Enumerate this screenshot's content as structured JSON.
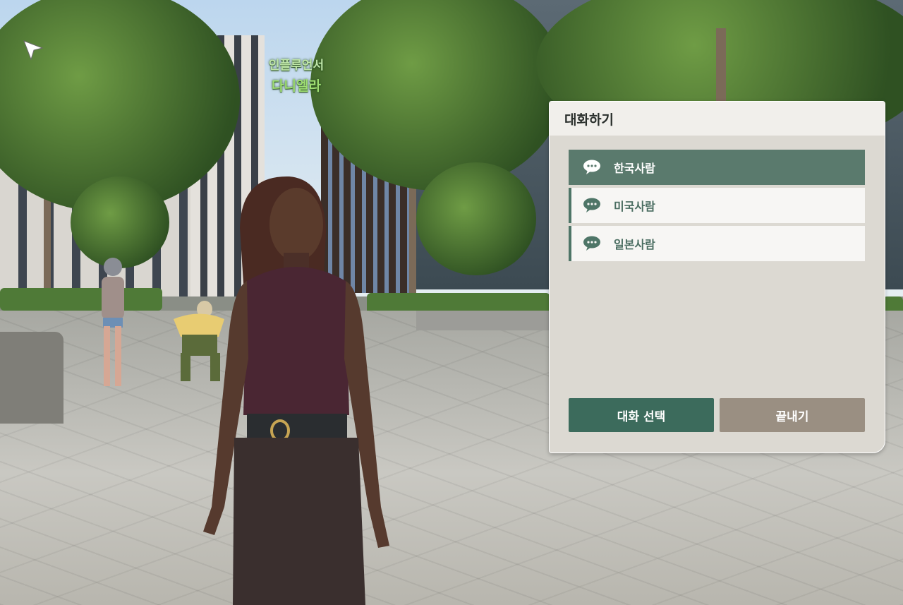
{
  "npc": {
    "title": "인플루언서",
    "name": "다니엘라"
  },
  "dialog": {
    "title": "대화하기",
    "options": [
      {
        "label": "한국사람",
        "icon": "speech-bubble-icon",
        "selected": true
      },
      {
        "label": "미국사람",
        "icon": "speech-bubble-icon",
        "selected": false
      },
      {
        "label": "일본사람",
        "icon": "speech-bubble-icon",
        "selected": false
      }
    ],
    "select_button": "대화 선택",
    "end_button": "끝내기"
  },
  "colors": {
    "selected_option": "#5a7a6d",
    "option_text": "#4a6d61",
    "select_button": "#3c6b5c",
    "end_button": "#9a8f82",
    "npc_label": "#9fde73"
  }
}
